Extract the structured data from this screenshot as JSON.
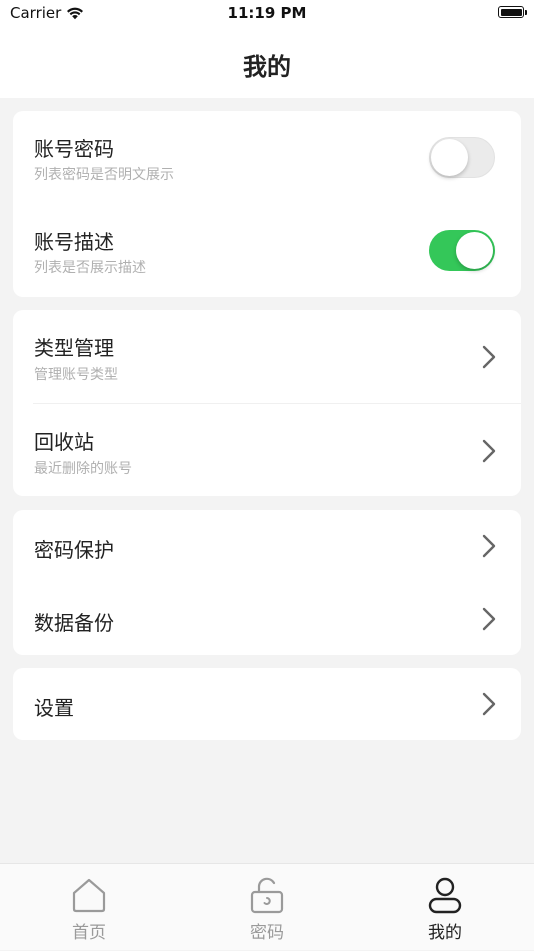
{
  "status_bar": {
    "carrier": "Carrier",
    "time": "11:19 PM",
    "wifi_icon": "wifi-icon",
    "battery_icon": "battery-icon"
  },
  "nav": {
    "title": "我的"
  },
  "display_settings": {
    "items": [
      {
        "title": "账号密码",
        "subtitle": "列表密码是否明文展示",
        "toggle_on": false
      },
      {
        "title": "账号描述",
        "subtitle": "列表是否展示描述",
        "toggle_on": true
      }
    ]
  },
  "manage_section": {
    "items": [
      {
        "title": "类型管理",
        "subtitle": "管理账号类型"
      },
      {
        "title": "回收站",
        "subtitle": "最近删除的账号"
      }
    ]
  },
  "security_section": {
    "items": [
      {
        "title": "密码保护"
      },
      {
        "title": "数据备份"
      }
    ]
  },
  "settings_section": {
    "items": [
      {
        "title": "设置"
      }
    ]
  },
  "tab_bar": {
    "tabs": [
      {
        "label": "首页",
        "icon": "home-icon",
        "active": false
      },
      {
        "label": "密码",
        "icon": "lock-icon",
        "active": false
      },
      {
        "label": "我的",
        "icon": "person-icon",
        "active": true
      }
    ]
  },
  "colors": {
    "toggle_on": "#34c759",
    "background": "#f3f3f3",
    "card": "#ffffff",
    "subtitle": "#b0b0b0"
  }
}
